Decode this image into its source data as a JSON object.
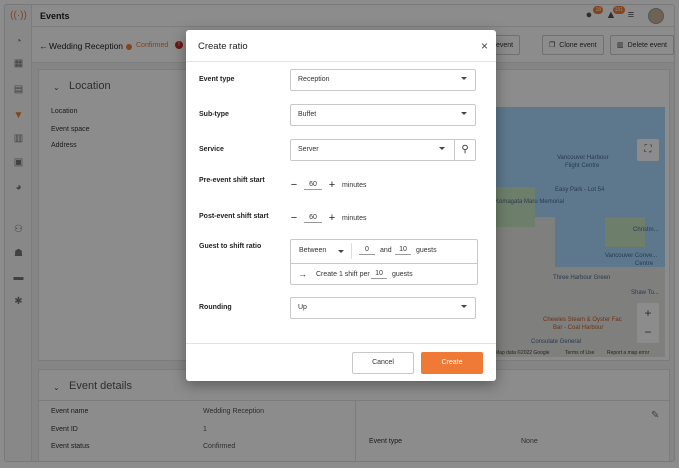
{
  "page_title": "Events",
  "top_bar": {
    "chat_badge": "18",
    "alert_badge": "151"
  },
  "event_header": {
    "back_arrow": "←",
    "event_name": "Wedding Reception",
    "status": "Confirmed",
    "info_icon": "!",
    "buttons": [
      {
        "label": "Export event",
        "visible_label": "port event",
        "icon": "export-icon"
      },
      {
        "label": "Clone event",
        "icon": "clone-icon"
      },
      {
        "label": "Delete event",
        "icon": "trash-icon"
      }
    ]
  },
  "location_section": {
    "title": "Location",
    "fields": [
      "Location",
      "Event space",
      "Address"
    ]
  },
  "map": {
    "labels": [
      "Vancouver Harbour",
      "Flight Centre",
      "Easy Park - Lot 54",
      "Komagata Maru Memorial",
      "Christm...",
      "Vancouver Conve...",
      "Centre",
      "Three Harbour Green",
      "Shaw To...",
      "Chewies Steam & Oyster Fac",
      "Bar - Coal Harbour",
      "Consulate General",
      "Map data ©2022 Google",
      "Terms of Use",
      "Report a map error"
    ]
  },
  "event_details": {
    "title": "Event details",
    "rows": [
      {
        "label": "Event name",
        "value": "Wedding Reception"
      },
      {
        "label": "Event ID",
        "value": "1"
      },
      {
        "label": "Event status",
        "value": "Confirmed"
      }
    ],
    "event_type_label": "Event type",
    "event_type_value": "None"
  },
  "modal": {
    "title": "Create ratio",
    "close": "×",
    "event_type": {
      "label": "Event type",
      "value": "Reception"
    },
    "sub_type": {
      "label": "Sub-type",
      "value": "Buffet"
    },
    "service": {
      "label": "Service",
      "value": "Server"
    },
    "pre_shift": {
      "label": "Pre-event shift start",
      "value": "60",
      "unit": "minutes"
    },
    "post_shift": {
      "label": "Post-event shift start",
      "value": "60",
      "unit": "minutes"
    },
    "guest_ratio": {
      "label": "Guest to shift ratio",
      "mode": "Between",
      "min": "0",
      "and": "and",
      "max": "10",
      "guests": "guests",
      "create_text": "Create 1 shift per",
      "per_value": "10",
      "per_unit": "guests"
    },
    "rounding": {
      "label": "Rounding",
      "value": "Up"
    },
    "cancel_label": "Cancel",
    "create_label": "Create"
  },
  "colors": {
    "accent": "#ef7a36",
    "danger": "#c62828"
  }
}
